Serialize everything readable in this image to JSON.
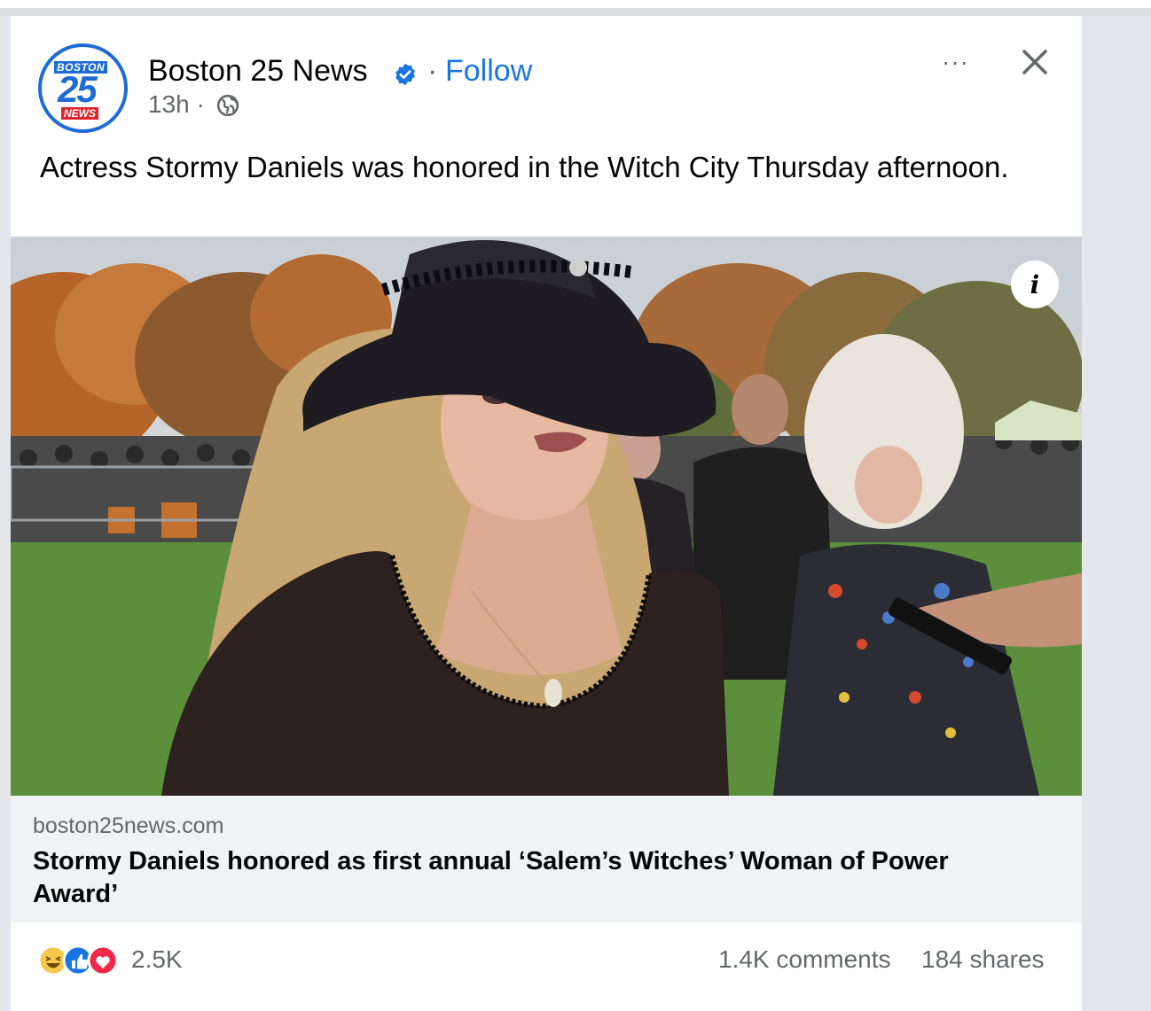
{
  "post": {
    "logo": {
      "top_text": "BOSTON",
      "number": "25",
      "bottom_text": "NEWS"
    },
    "page_name": "Boston 25 News",
    "separator": "·",
    "follow_label": "Follow",
    "timestamp": "13h ·",
    "more_label": "···",
    "caption": "Actress Stormy Daniels was honored in the Witch City Thursday afternoon.",
    "info_label": "i"
  },
  "link": {
    "domain": "boston25news.com",
    "headline": "Stormy Daniels honored as first annual ‘Salem’s Witches’ Woman of Power Award’"
  },
  "footer": {
    "reactions": [
      "haha-icon",
      "like-icon",
      "love-icon"
    ],
    "reaction_count": "2.5K",
    "comments": "1.4K comments",
    "shares": "184 shares"
  },
  "colors": {
    "accent": "#1b74e4",
    "brand_blue": "#1f6bd6",
    "brand_red": "#e0232a",
    "secondary_text": "#65676b"
  }
}
